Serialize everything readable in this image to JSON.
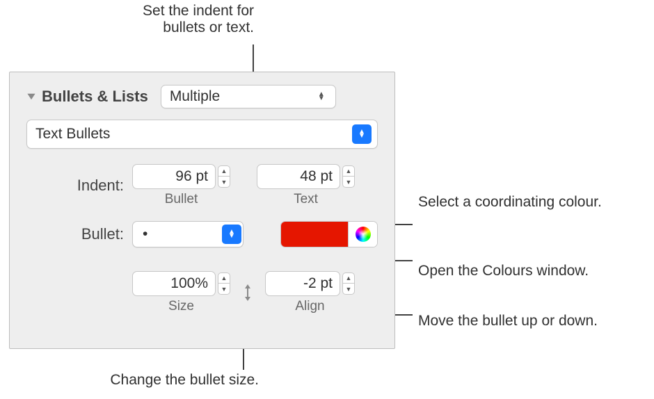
{
  "callouts": {
    "top": "Set the indent for bullets or text.",
    "bottom": "Change the bullet size.",
    "right1": "Select a coordinating colour.",
    "right2": "Open the Colours window.",
    "right3": "Move the bullet up or down."
  },
  "panel": {
    "section_title": "Bullets & Lists",
    "style_popup": "Multiple",
    "type_popup": "Text Bullets",
    "indent": {
      "label": "Indent:",
      "bullet_value": "96 pt",
      "bullet_sub": "Bullet",
      "text_value": "48 pt",
      "text_sub": "Text"
    },
    "bullet": {
      "label": "Bullet:",
      "char": "•"
    },
    "size": {
      "value": "100%",
      "sub": "Size"
    },
    "align": {
      "value": "-2 pt",
      "sub": "Align"
    }
  }
}
